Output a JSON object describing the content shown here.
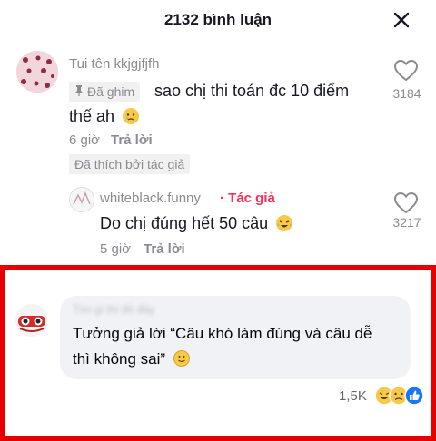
{
  "header": {
    "title": "2132 bình luận"
  },
  "comment": {
    "username": "Tui tên kkjgjfjfh",
    "pinned_label": "Đã ghim",
    "text_line1": "sao chị thi toán đc 10 điểm",
    "text_line2": "thế ah",
    "time": "6 giờ",
    "reply_label": "Trả lời",
    "liked_by_author": "Đã thích bởi tác giả",
    "like_count": "3184"
  },
  "reply": {
    "username": "whiteblack.funny",
    "author_tag": "· Tác giả",
    "text": "Do chị đúng hết 50 câu",
    "time": "5 giờ",
    "reply_label": "Trả lời",
    "like_count": "3217"
  },
  "fb_comment": {
    "author_name": "Tìm gì thì đỏ đây",
    "text_line1": "Tưởng giả lời “Câu khó làm đúng và câu dễ",
    "text_line2": "thì không sai”",
    "reaction_count": "1,5K"
  },
  "colors": {
    "accent": "#fe2c55",
    "highlight": "#e60000",
    "bubble": "#f0f2f5"
  }
}
